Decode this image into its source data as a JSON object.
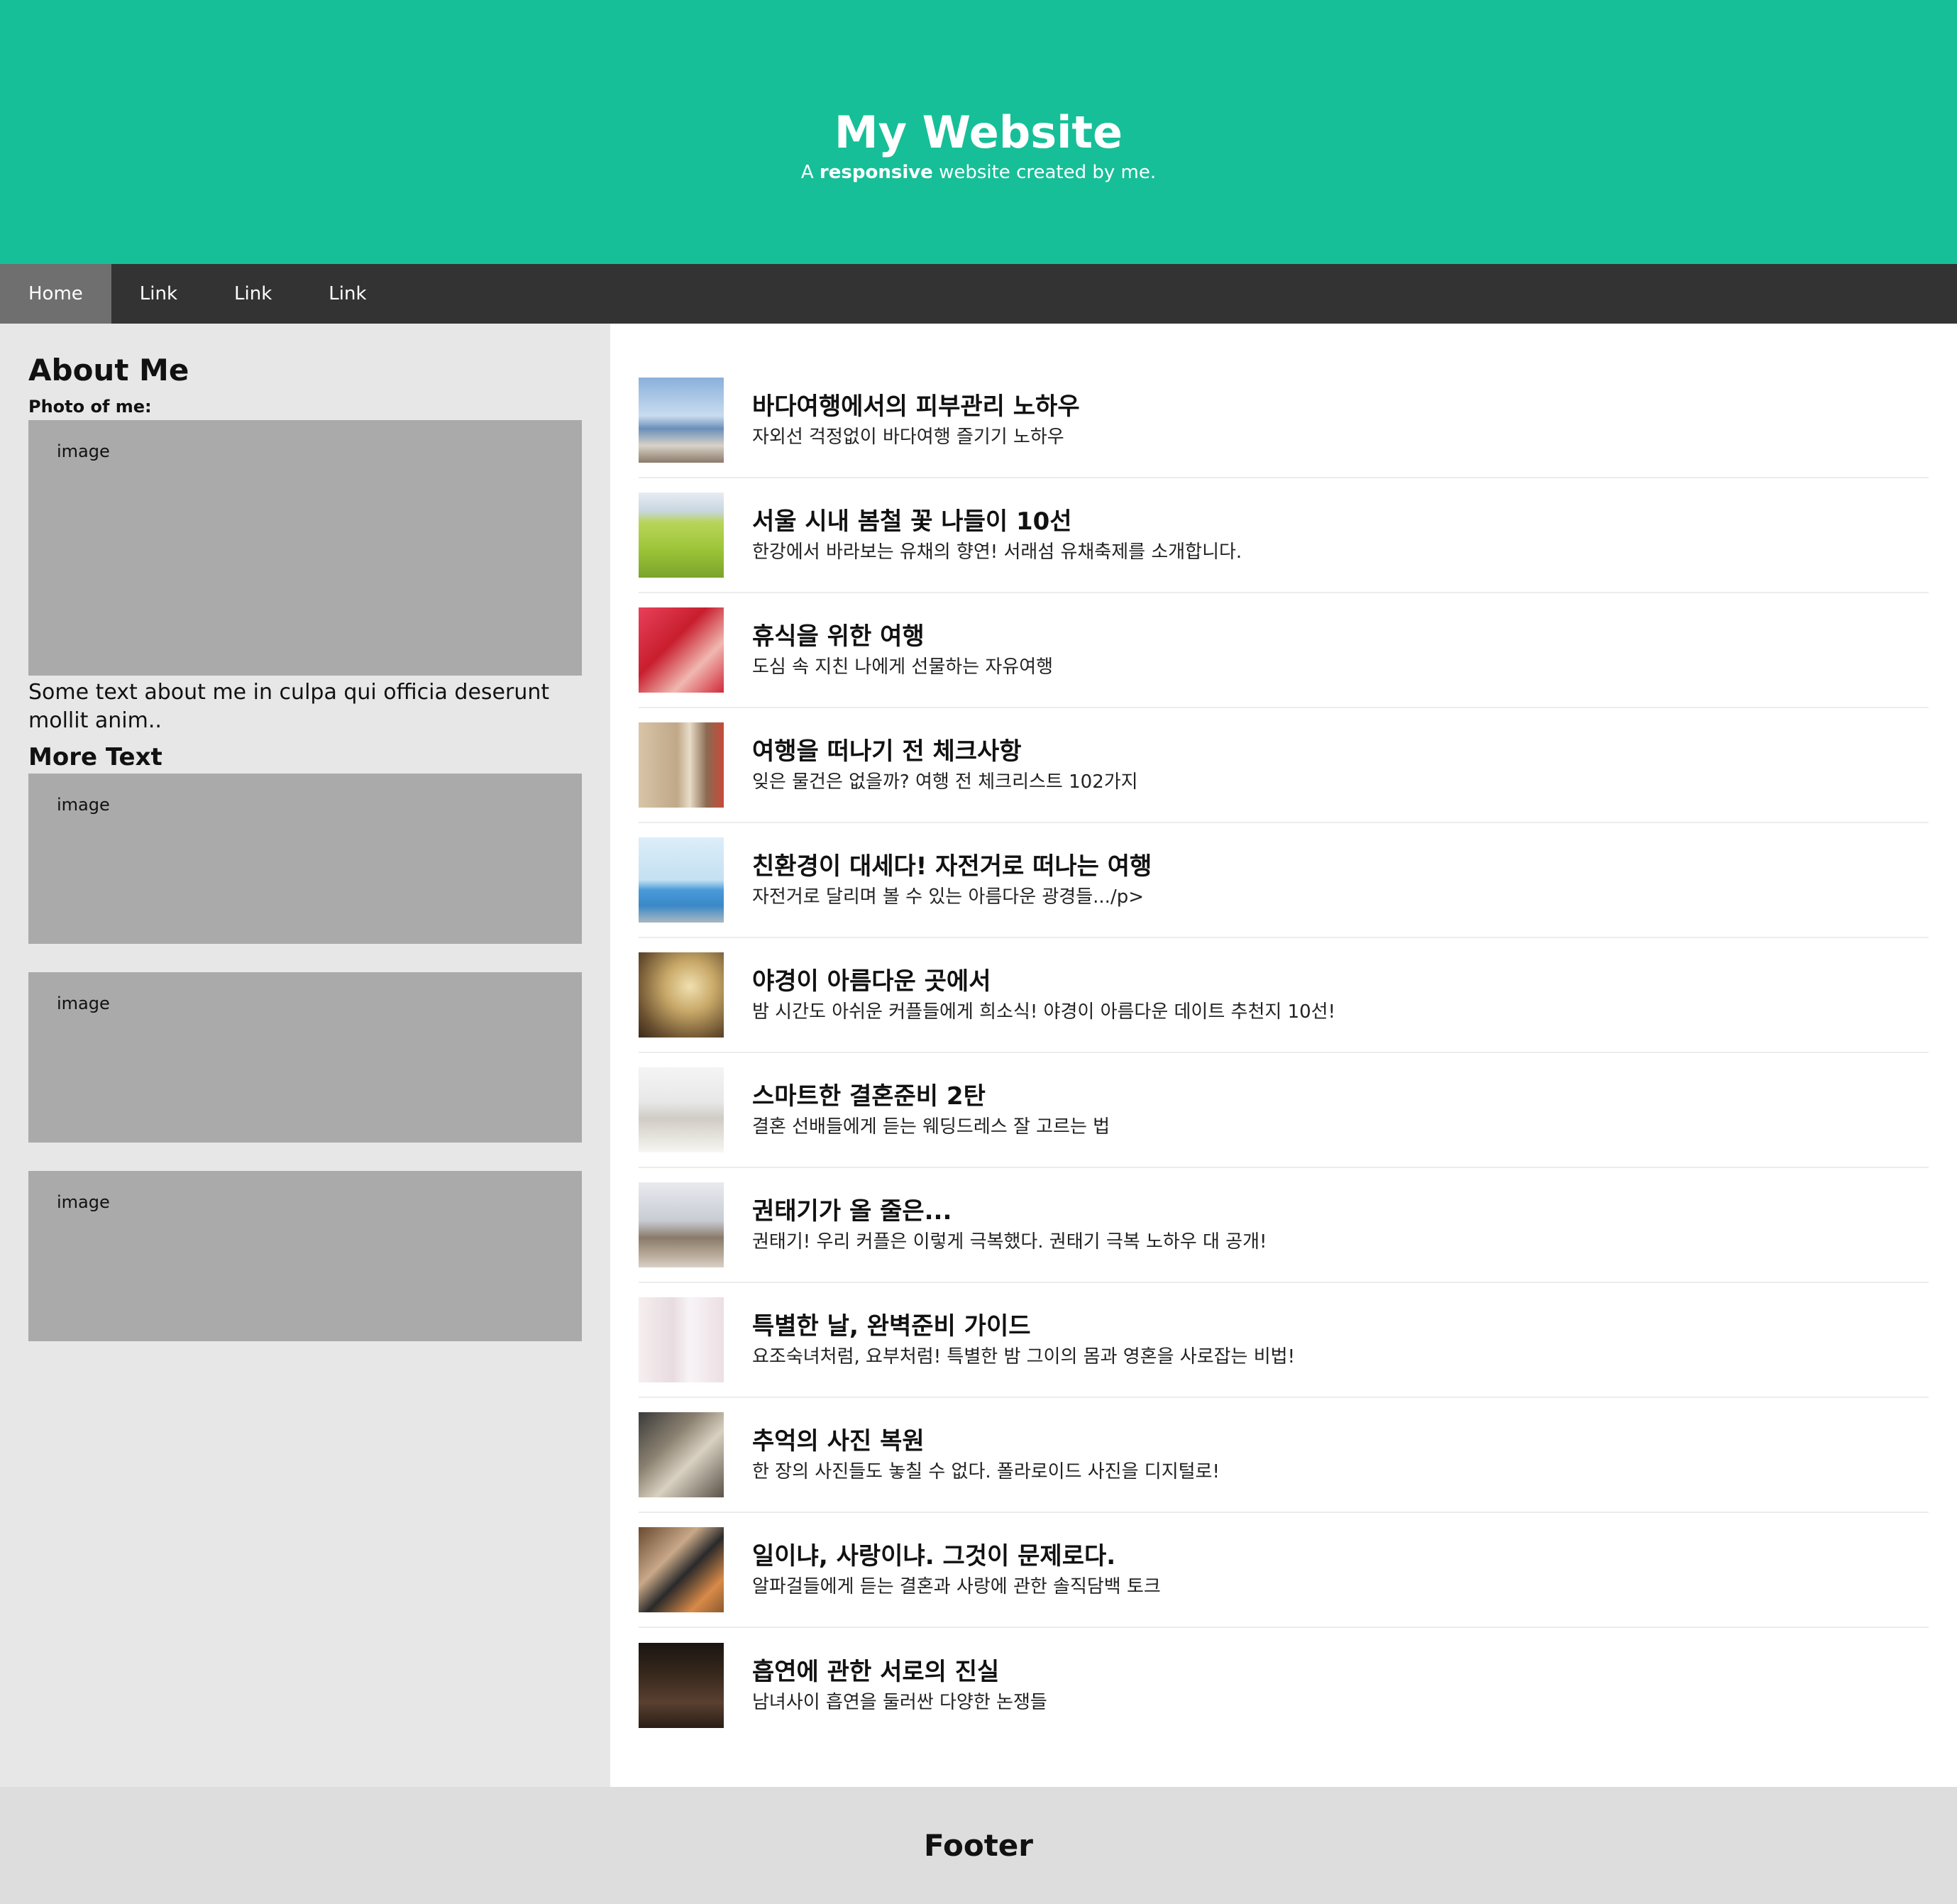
{
  "header": {
    "title": "My Website",
    "tagline_prefix": "A ",
    "tagline_bold": "responsive",
    "tagline_suffix": " website created by me."
  },
  "nav": {
    "items": [
      {
        "label": "Home",
        "active": true
      },
      {
        "label": "Link",
        "active": false
      },
      {
        "label": "Link",
        "active": false
      },
      {
        "label": "Link",
        "active": false
      }
    ]
  },
  "side": {
    "heading": "About Me",
    "photo_label": "Photo of me:",
    "image_placeholder": "image",
    "about_text": "Some text about me in culpa qui officia deserunt mollit anim..",
    "more_heading": "More Text",
    "more_images": [
      "image",
      "image",
      "image"
    ]
  },
  "posts": [
    {
      "title": "바다여행에서의 피부관리 노하우",
      "desc": "자외선 걱정없이 바다여행 즐기기 노하우"
    },
    {
      "title": "서울 시내 봄철 꽃 나들이 10선",
      "desc": "한강에서 바라보는 유채의 향연! 서래섬 유채축제를 소개합니다."
    },
    {
      "title": "휴식을 위한 여행",
      "desc": "도심 속 지친 나에게 선물하는 자유여행"
    },
    {
      "title": "여행을 떠나기 전 체크사항",
      "desc": "잊은 물건은 없을까? 여행 전 체크리스트 102가지"
    },
    {
      "title": "친환경이 대세다! 자전거로 떠나는 여행",
      "desc": "자전거로 달리며 볼 수 있는 아름다운 광경들.../p>"
    },
    {
      "title": "야경이 아름다운 곳에서",
      "desc": "밤 시간도 아쉬운 커플들에게 희소식! 야경이 아름다운 데이트 추천지 10선!"
    },
    {
      "title": "스마트한 결혼준비 2탄",
      "desc": "결혼 선배들에게 듣는 웨딩드레스 잘 고르는 법"
    },
    {
      "title": "권태기가 올 줄은...",
      "desc": "권태기! 우리 커플은 이렇게 극복했다. 권태기 극복 노하우 대 공개!"
    },
    {
      "title": "특별한 날, 완벽준비 가이드",
      "desc": "요조숙녀처럼, 요부처럼! 특별한 밤 그이의 몸과 영혼을 사로잡는 비법!"
    },
    {
      "title": "추억의 사진 복원",
      "desc": "한 장의 사진들도 놓칠 수 없다. 폴라로이드 사진을 디지털로!"
    },
    {
      "title": "일이냐, 사랑이냐. 그것이 문제로다.",
      "desc": "알파걸들에게 듣는 결혼과 사랑에 관한 솔직담백 토크"
    },
    {
      "title": "흡연에 관한 서로의 진실",
      "desc": "남녀사이 흡연을 둘러싼 다양한 논쟁들"
    }
  ],
  "footer": {
    "text": "Footer"
  }
}
